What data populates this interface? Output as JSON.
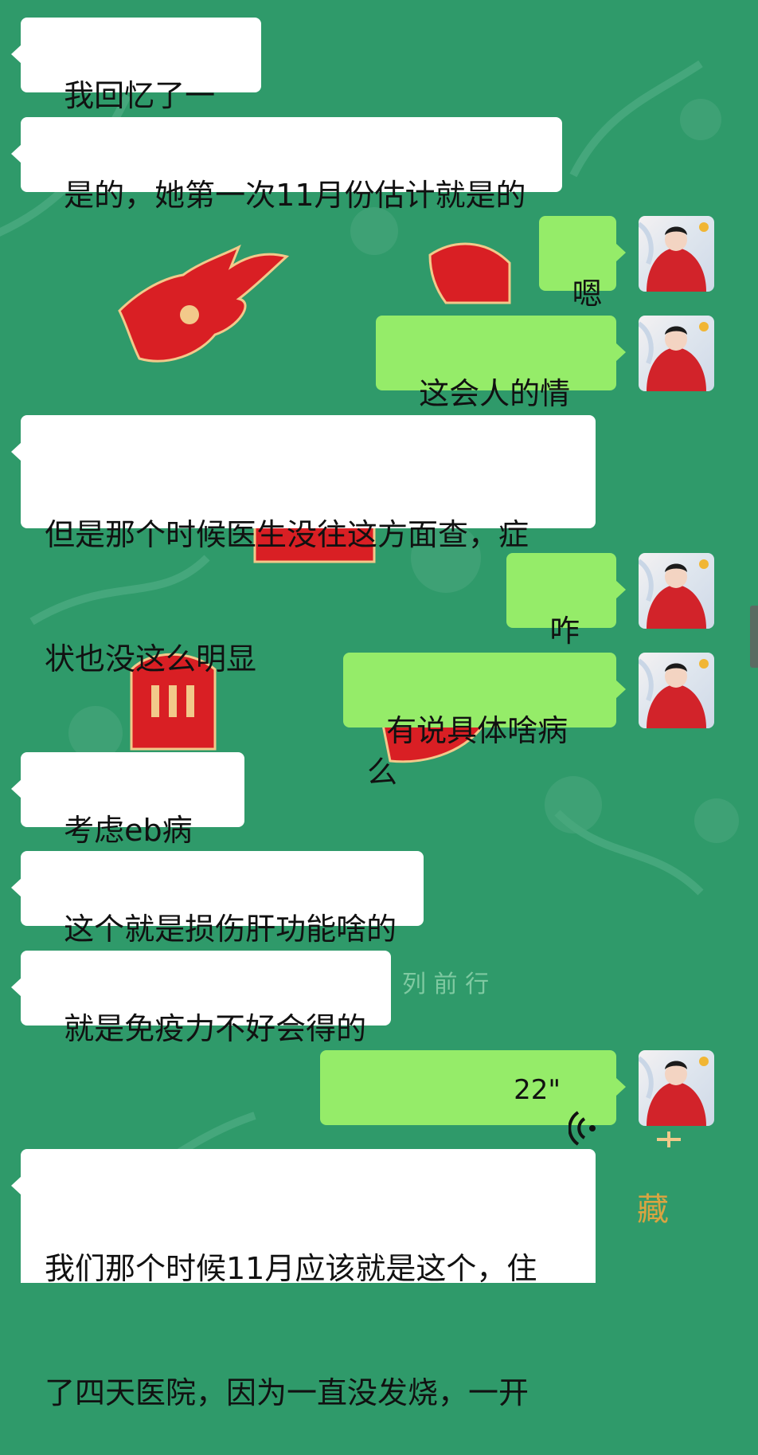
{
  "chat": {
    "messages": [
      {
        "side": "in",
        "text": "我回忆了一下"
      },
      {
        "side": "in",
        "text": "是的，她第一次11月份估计就是的"
      },
      {
        "side": "out",
        "text": "嗯"
      },
      {
        "side": "out",
        "text": "这会人的情况"
      },
      {
        "side": "in",
        "line1": "但是那个时候医生没往这方面查，症",
        "line2": "状也没这么明显"
      },
      {
        "side": "out",
        "text": "咋样"
      },
      {
        "side": "out",
        "text": "有说具体啥病么"
      },
      {
        "side": "in",
        "text": "考虑eb病毒"
      },
      {
        "side": "in",
        "text": "这个就是损伤肝功能啥的"
      },
      {
        "side": "in",
        "text": "就是免疫力不好会得的"
      },
      {
        "side": "out",
        "type": "voice",
        "duration": "22\""
      },
      {
        "side": "in",
        "line1": "我们那个时候11月应该就是这个，住",
        "line2": "了四天医院，因为一直没发烧，一开"
      }
    ]
  },
  "wallpaper": {
    "text_1": "列 前 行",
    "text_2": "藏"
  },
  "colors": {
    "background": "#2f9a6a",
    "incoming_bubble": "#ffffff",
    "outgoing_bubble": "#95ec69"
  },
  "icons": {
    "avatar": "avatar-photo",
    "voice": "voice-wave-icon"
  }
}
